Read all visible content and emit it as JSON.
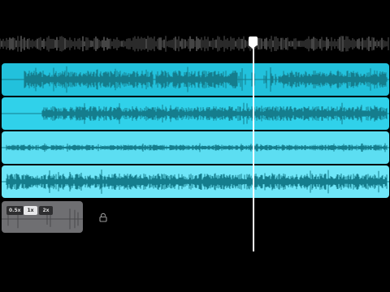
{
  "colors": {
    "background": "#000000",
    "track_1": "#22c1dc",
    "track_2": "#30d1ea",
    "track_3": "#5cdef2",
    "track_4": "#6fe6f8",
    "waveform": "#157d8d",
    "playhead": "#ffffff",
    "speed_panel": "#6f6f72"
  },
  "timeline": {
    "tracks": [
      {
        "name": "track-1",
        "amplitude": 0.55
      },
      {
        "name": "track-2",
        "amplitude": 0.45
      },
      {
        "name": "track-3",
        "amplitude": 0.18
      },
      {
        "name": "track-4",
        "amplitude": 0.5
      }
    ],
    "playhead_icon": "playhead-handle-icon"
  },
  "speed": {
    "options": [
      "0.5x",
      "1x",
      "2x"
    ],
    "selected": "1x"
  },
  "lock": {
    "icon": "lock-icon"
  }
}
